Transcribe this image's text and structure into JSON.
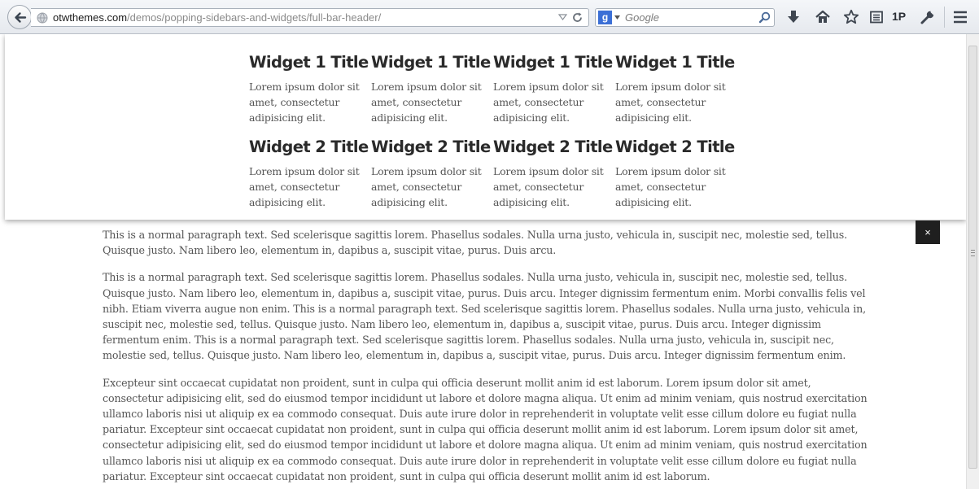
{
  "browser": {
    "url_host": "otwthemes.com",
    "url_path": "/demos/popping-sidebars-and-widgets/full-bar-header/",
    "search_engine_label": "g",
    "search_placeholder": "Google",
    "onepassword_label": "1P"
  },
  "widget_area": {
    "rows": [
      {
        "widgets": [
          {
            "title": "Widget 1 Title",
            "body": "Lorem ipsum dolor sit amet, consectetur adipisicing elit."
          },
          {
            "title": "Widget 1 Title",
            "body": "Lorem ipsum dolor sit amet, consectetur adipisicing elit."
          },
          {
            "title": "Widget 1 Title",
            "body": "Lorem ipsum dolor sit amet, consectetur adipisicing elit."
          },
          {
            "title": "Widget 1 Title",
            "body": "Lorem ipsum dolor sit amet, consectetur adipisicing elit."
          }
        ]
      },
      {
        "widgets": [
          {
            "title": "Widget 2 Title",
            "body": "Lorem ipsum dolor sit amet, consectetur adipisicing elit."
          },
          {
            "title": "Widget 2 Title",
            "body": "Lorem ipsum dolor sit amet, consectetur adipisicing elit."
          },
          {
            "title": "Widget 2 Title",
            "body": "Lorem ipsum dolor sit amet, consectetur adipisicing elit."
          },
          {
            "title": "Widget 2 Title",
            "body": "Lorem ipsum dolor sit amet, consectetur adipisicing elit."
          }
        ]
      }
    ],
    "close_label": "×"
  },
  "content": {
    "paragraphs": [
      "This is a normal paragraph text. Sed scelerisque sagittis lorem. Phasellus sodales. Nulla urna justo, vehicula in, suscipit nec, molestie sed, tellus. Quisque justo. Nam libero leo, elementum in, dapibus a, suscipit vitae, purus. Duis arcu.",
      "This is a normal paragraph text. Sed scelerisque sagittis lorem. Phasellus sodales. Nulla urna justo, vehicula in, suscipit nec, molestie sed, tellus. Quisque justo. Nam libero leo, elementum in, dapibus a, suscipit vitae, purus. Duis arcu. Integer dignissim fermentum enim. Morbi convallis felis vel nibh. Etiam viverra augue non enim. This is a normal paragraph text. Sed scelerisque sagittis lorem. Phasellus sodales. Nulla urna justo, vehicula in, suscipit nec, molestie sed, tellus. Quisque justo. Nam libero leo, elementum in, dapibus a, suscipit vitae, purus. Duis arcu. Integer dignissim fermentum enim. This is a normal paragraph text. Sed scelerisque sagittis lorem. Phasellus sodales. Nulla urna justo, vehicula in, suscipit nec, molestie sed, tellus. Quisque justo. Nam libero leo, elementum in, dapibus a, suscipit vitae, purus. Duis arcu. Integer dignissim fermentum enim.",
      "Excepteur sint occaecat cupidatat non proident, sunt in culpa qui officia deserunt mollit anim id est laborum. Lorem ipsum dolor sit amet, consectetur adipisicing elit, sed do eiusmod tempor incididunt ut labore et dolore magna aliqua. Ut enim ad minim veniam, quis nostrud exercitation ullamco laboris nisi ut aliquip ex ea commodo consequat. Duis aute irure dolor in reprehenderit in voluptate velit esse cillum dolore eu fugiat nulla pariatur. Excepteur sint occaecat cupidatat non proident, sunt in culpa qui officia deserunt mollit anim id est laborum. Lorem ipsum dolor sit amet, consectetur adipisicing elit, sed do eiusmod tempor incididunt ut labore et dolore magna aliqua. Ut enim ad minim veniam, quis nostrud exercitation ullamco laboris nisi ut aliquip ex ea commodo consequat. Duis aute irure dolor in reprehenderit in voluptate velit esse cillum dolore eu fugiat nulla pariatur. Excepteur sint occaecat cupidatat non proident, sunt in culpa qui officia deserunt mollit anim id est laborum."
    ]
  },
  "icons": {
    "toolbar": [
      "back-arrow-icon",
      "globe-icon",
      "dropmarker-icon",
      "reload-icon",
      "google-icon",
      "magnifier-icon",
      "download-icon",
      "home-icon",
      "star-icon",
      "reading-list-icon",
      "1password-icon",
      "wrench-icon",
      "hamburger-menu-icon"
    ]
  }
}
